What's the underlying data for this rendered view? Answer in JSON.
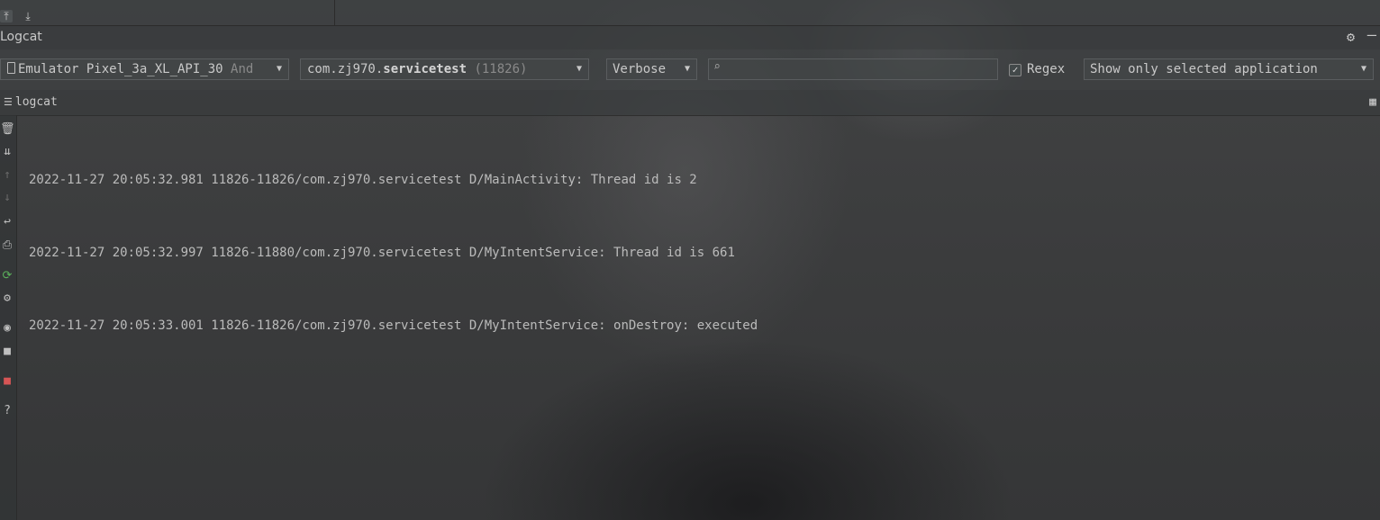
{
  "panel": {
    "title": "Logcat"
  },
  "toolbar": {
    "device": {
      "name": "Emulator Pixel_3a_XL_API_30",
      "suffix": "And"
    },
    "process": {
      "package_prefix": "com.zj970.",
      "package_name": "servicetest",
      "pid": "(11826)"
    },
    "level": "Verbose",
    "search": {
      "value": "",
      "placeholder": ""
    },
    "regex": {
      "label": "Regex",
      "checked": true
    },
    "filter": "Show only selected application"
  },
  "tab": {
    "label": "logcat"
  },
  "logs": [
    "2022-11-27 20:05:32.981 11826-11826/com.zj970.servicetest D/MainActivity: Thread id is 2",
    "2022-11-27 20:05:32.997 11826-11880/com.zj970.servicetest D/MyIntentService: Thread id is 661",
    "2022-11-27 20:05:33.001 11826-11826/com.zj970.servicetest D/MyIntentService: onDestroy: executed"
  ],
  "colors": {
    "background": "#3a3b3c",
    "text": "#bbbbbb",
    "record_button": "#d65555",
    "restart_icon": "#5bb15b"
  },
  "icons": [
    "scroll-to-top-icon",
    "scroll-to-end-icon",
    "gear-icon",
    "minimize-icon",
    "trash-icon",
    "soft-wrap-icon",
    "print-icon",
    "restart-icon",
    "settings-icon",
    "screenshot-icon",
    "video-icon",
    "stop-icon",
    "help-icon"
  ]
}
